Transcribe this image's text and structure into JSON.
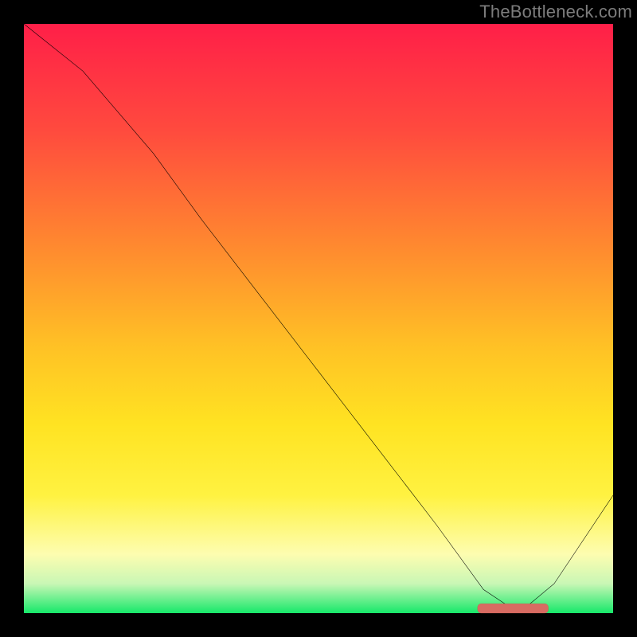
{
  "watermark": "TheBottleneck.com",
  "colors": {
    "grad_top": "#ff1f48",
    "grad_bottom": "#17e86a",
    "curve": "#000000",
    "marker_fill": "#d86b62",
    "marker_stroke": "#b94a44"
  },
  "chart_data": {
    "type": "line",
    "title": "",
    "xlabel": "",
    "ylabel": "",
    "xlim": [
      0,
      100
    ],
    "ylim": [
      0,
      100
    ],
    "series": [
      {
        "name": "curve",
        "x": [
          0,
          10,
          22,
          30,
          40,
          50,
          60,
          70,
          78,
          84,
          90,
          100
        ],
        "y": [
          100,
          92,
          78,
          67,
          54,
          41,
          28,
          15,
          4,
          0,
          5,
          20
        ]
      }
    ],
    "marker": {
      "x_start": 77,
      "x_end": 89,
      "y": 0
    }
  }
}
